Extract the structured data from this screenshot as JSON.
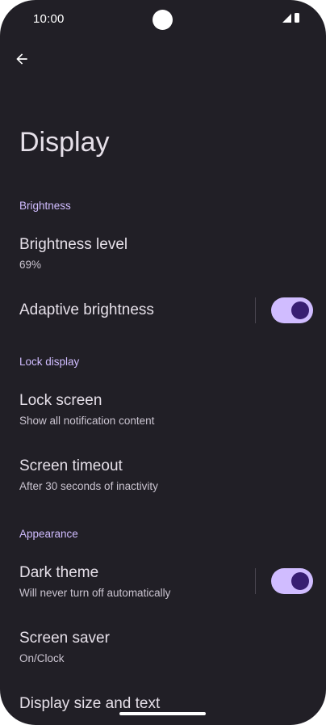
{
  "status_bar": {
    "time": "10:00",
    "icons": [
      "camera-cutout",
      "signal-icon",
      "battery-icon"
    ]
  },
  "header": {
    "back_icon": "arrow-back-icon",
    "title": "Display"
  },
  "sections": {
    "brightness": {
      "label": "Brightness",
      "brightness_level": {
        "title": "Brightness level",
        "summary": "69%"
      },
      "adaptive_brightness": {
        "title": "Adaptive brightness",
        "enabled": true
      }
    },
    "lock_display": {
      "label": "Lock display",
      "lock_screen": {
        "title": "Lock screen",
        "summary": "Show all notification content"
      },
      "screen_timeout": {
        "title": "Screen timeout",
        "summary": "After 30 seconds of inactivity"
      }
    },
    "appearance": {
      "label": "Appearance",
      "dark_theme": {
        "title": "Dark theme",
        "summary": "Will never turn off automatically",
        "enabled": true
      },
      "screen_saver": {
        "title": "Screen saver",
        "summary": "On/Clock"
      },
      "display_size": {
        "title": "Display size and text"
      }
    }
  },
  "colors": {
    "background": "#211f26",
    "accent": "#d0bcff",
    "switch_thumb": "#381e72",
    "text_primary": "#e6e0e9",
    "text_secondary": "#cac4d0"
  }
}
